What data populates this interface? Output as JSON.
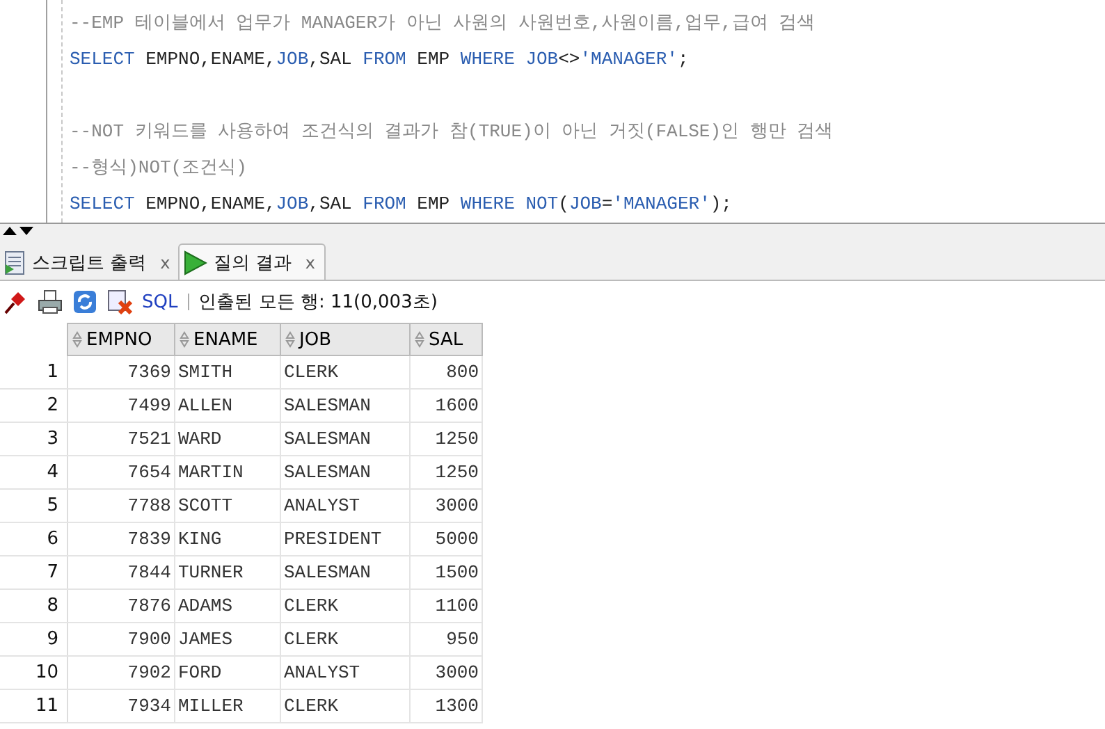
{
  "editor": {
    "lines": [
      {
        "kind": "code",
        "tokens": [
          {
            "kind": "comment",
            "text": "--EMP 테이블에서 업무가 MANAGER가 아닌 사원의 사원번호,사원이름,업무,급여 검색"
          }
        ]
      },
      {
        "kind": "code",
        "tokens": [
          {
            "kind": "keyword",
            "text": "SELECT"
          },
          {
            "kind": "plain",
            "text": " EMPNO,ENAME,"
          },
          {
            "kind": "keyword",
            "text": "JOB"
          },
          {
            "kind": "plain",
            "text": ",SAL "
          },
          {
            "kind": "keyword",
            "text": "FROM"
          },
          {
            "kind": "plain",
            "text": " EMP "
          },
          {
            "kind": "keyword",
            "text": "WHERE"
          },
          {
            "kind": "keyword",
            "text": " JOB"
          },
          {
            "kind": "plain",
            "text": "<>"
          },
          {
            "kind": "string",
            "text": "'MANAGER'"
          },
          {
            "kind": "plain",
            "text": ";"
          }
        ]
      },
      {
        "kind": "blank"
      },
      {
        "kind": "code",
        "tokens": [
          {
            "kind": "comment",
            "text": "--NOT 키워드를 사용하여 조건식의 결과가 참(TRUE)이 아닌 거짓(FALSE)인 행만 검색"
          }
        ]
      },
      {
        "kind": "code",
        "tokens": [
          {
            "kind": "comment",
            "text": "--형식)NOT(조건식)"
          }
        ]
      },
      {
        "kind": "code",
        "tokens": [
          {
            "kind": "keyword",
            "text": "SELECT"
          },
          {
            "kind": "plain",
            "text": " EMPNO,ENAME,"
          },
          {
            "kind": "keyword",
            "text": "JOB"
          },
          {
            "kind": "plain",
            "text": ",SAL "
          },
          {
            "kind": "keyword",
            "text": "FROM"
          },
          {
            "kind": "plain",
            "text": " EMP "
          },
          {
            "kind": "keyword",
            "text": "WHERE"
          },
          {
            "kind": "keyword",
            "text": " NOT"
          },
          {
            "kind": "plain",
            "text": "("
          },
          {
            "kind": "keyword",
            "text": "JOB"
          },
          {
            "kind": "plain",
            "text": "="
          },
          {
            "kind": "string",
            "text": "'MANAGER'"
          },
          {
            "kind": "plain",
            "text": ");"
          }
        ]
      }
    ]
  },
  "tabs": [
    {
      "kind": "script",
      "label": "스크립트 출력",
      "close": "x",
      "selected": false
    },
    {
      "kind": "query",
      "label": "질의 결과",
      "close": "x",
      "selected": true
    }
  ],
  "toolbar": {
    "sql": "SQL",
    "status": "인출된 모든 행: 11(0,003초)"
  },
  "table": {
    "columns": [
      "EMPNO",
      "ENAME",
      "JOB",
      "SAL"
    ],
    "rows": [
      {
        "number": "1",
        "cells": [
          "7369",
          "SMITH",
          "CLERK",
          "800"
        ]
      },
      {
        "number": "2",
        "cells": [
          "7499",
          "ALLEN",
          "SALESMAN",
          "1600"
        ]
      },
      {
        "number": "3",
        "cells": [
          "7521",
          "WARD",
          "SALESMAN",
          "1250"
        ]
      },
      {
        "number": "4",
        "cells": [
          "7654",
          "MARTIN",
          "SALESMAN",
          "1250"
        ]
      },
      {
        "number": "5",
        "cells": [
          "7788",
          "SCOTT",
          "ANALYST",
          "3000"
        ]
      },
      {
        "number": "6",
        "cells": [
          "7839",
          "KING",
          "PRESIDENT",
          "5000"
        ]
      },
      {
        "number": "7",
        "cells": [
          "7844",
          "TURNER",
          "SALESMAN",
          "1500"
        ]
      },
      {
        "number": "8",
        "cells": [
          "7876",
          "ADAMS",
          "CLERK",
          "1100"
        ]
      },
      {
        "number": "9",
        "cells": [
          "7900",
          "JAMES",
          "CLERK",
          "950"
        ]
      },
      {
        "number": "10",
        "cells": [
          "7902",
          "FORD",
          "ANALYST",
          "3000"
        ]
      },
      {
        "number": "11",
        "cells": [
          "7934",
          "MILLER",
          "CLERK",
          "1300"
        ]
      }
    ]
  }
}
